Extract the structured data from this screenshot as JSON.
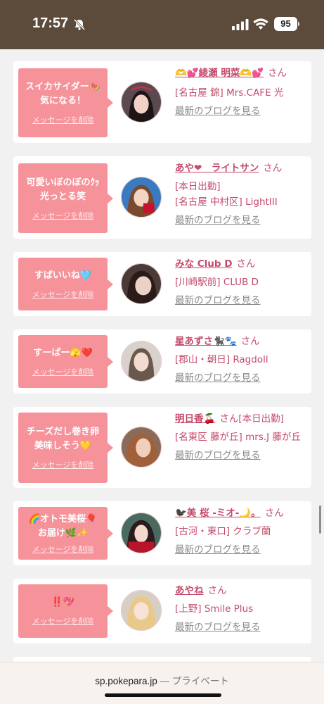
{
  "status_bar": {
    "time": "17:57",
    "battery": "95"
  },
  "cards": [
    {
      "message": "スイカサイダー🍉\n気になる！",
      "delete_label": "メッセージを削除",
      "name": "🫶💕綾瀬 明菜🫶💕",
      "honorific": "さん",
      "shop": [
        "[名古屋 錦] Mrs.CAFE 光"
      ],
      "blog_label": "最新のブログを見る"
    },
    {
      "message": "可愛いぼのぼのｸｯ\n光っとる笑",
      "delete_label": "メッセージを削除",
      "name": "あや❤︎　ライトサン",
      "honorific": "さん",
      "shop": [
        "[本日出勤]",
        "[名古屋 中村区] LightIII"
      ],
      "blog_label": "最新のブログを見る"
    },
    {
      "message": "すばいいね🩵",
      "delete_label": "メッセージを削除",
      "name": "みな Club D",
      "honorific": "さん",
      "shop": [
        "[川崎駅前] CLUB D"
      ],
      "blog_label": "最新のブログを見る"
    },
    {
      "message": "すーぱー🫣❤️",
      "delete_label": "メッセージを削除",
      "name": "星あずさ🐈‍⬛🐾",
      "honorific": "さん",
      "shop": [
        "[郡山・朝日] Ragdoll"
      ],
      "blog_label": "最新のブログを見る"
    },
    {
      "message": "チーズだし巻き卵\n美味しそう💛",
      "delete_label": "メッセージを削除",
      "name": "明日香🍒",
      "honorific": "さん[本日出勤]",
      "shop": [
        "[名東区 藤が丘] mrs.J 藤が丘"
      ],
      "blog_label": "最新のブログを見る"
    },
    {
      "message": "🌈オトモ美桜🎈\nお届け🌿✨",
      "delete_label": "メッセージを削除",
      "name": "🐦‍⬛美 桜 -ミオ-🌙。",
      "honorific": "さん",
      "shop": [
        "[古河・東口] クラブ蘭"
      ],
      "blog_label": "最新のブログを見る"
    },
    {
      "message": "‼️💖",
      "delete_label": "メッセージを削除",
      "name": "あやね",
      "honorific": "さん",
      "shop": [
        "[上野] Smile Plus"
      ],
      "blog_label": "最新のブログを見る"
    }
  ],
  "url_bar": {
    "domain": "sp.pokepara.jp",
    "separator": " — ",
    "mode": "プライベート"
  },
  "colors": {
    "status_bar": "#5c4a3b",
    "bubble": "#f6929a",
    "accent": "#c44a6b",
    "background": "#f1f1f1"
  }
}
